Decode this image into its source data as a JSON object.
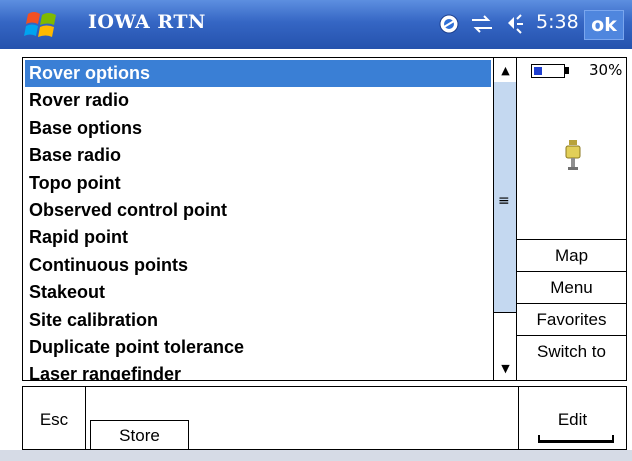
{
  "titlebar": {
    "title": "IOWA RTN",
    "time": "5:38",
    "ok_label": "ok",
    "icons": [
      "windows-start-icon",
      "satellite-icon",
      "connectivity-icon",
      "volume-icon"
    ]
  },
  "list": {
    "selected_index": 0,
    "items": [
      "Rover options",
      "Rover radio",
      "Base options",
      "Base radio",
      "Topo point",
      "Observed control point",
      "Rapid point",
      "Continuous points",
      "Stakeout",
      "Site calibration",
      "Duplicate point tolerance",
      "Laser rangefinder"
    ]
  },
  "scrollbar": {
    "grip_glyph": "≡",
    "up_glyph": "▲",
    "down_glyph": "▼"
  },
  "status_panel": {
    "battery_percent_label": "30%",
    "battery_level": 0.3,
    "instrument_icon": "gps-receiver-icon"
  },
  "side_buttons": [
    "Map",
    "Menu",
    "Favorites",
    "Switch to"
  ],
  "bottom": {
    "esc_label": "Esc",
    "store_label": "Store",
    "edit_label": "Edit"
  },
  "colors": {
    "titlebar": "#3566c4",
    "selection": "#3a7fd5",
    "scroll_thumb": "#c4d8f0",
    "battery": "#1f3fcf"
  }
}
